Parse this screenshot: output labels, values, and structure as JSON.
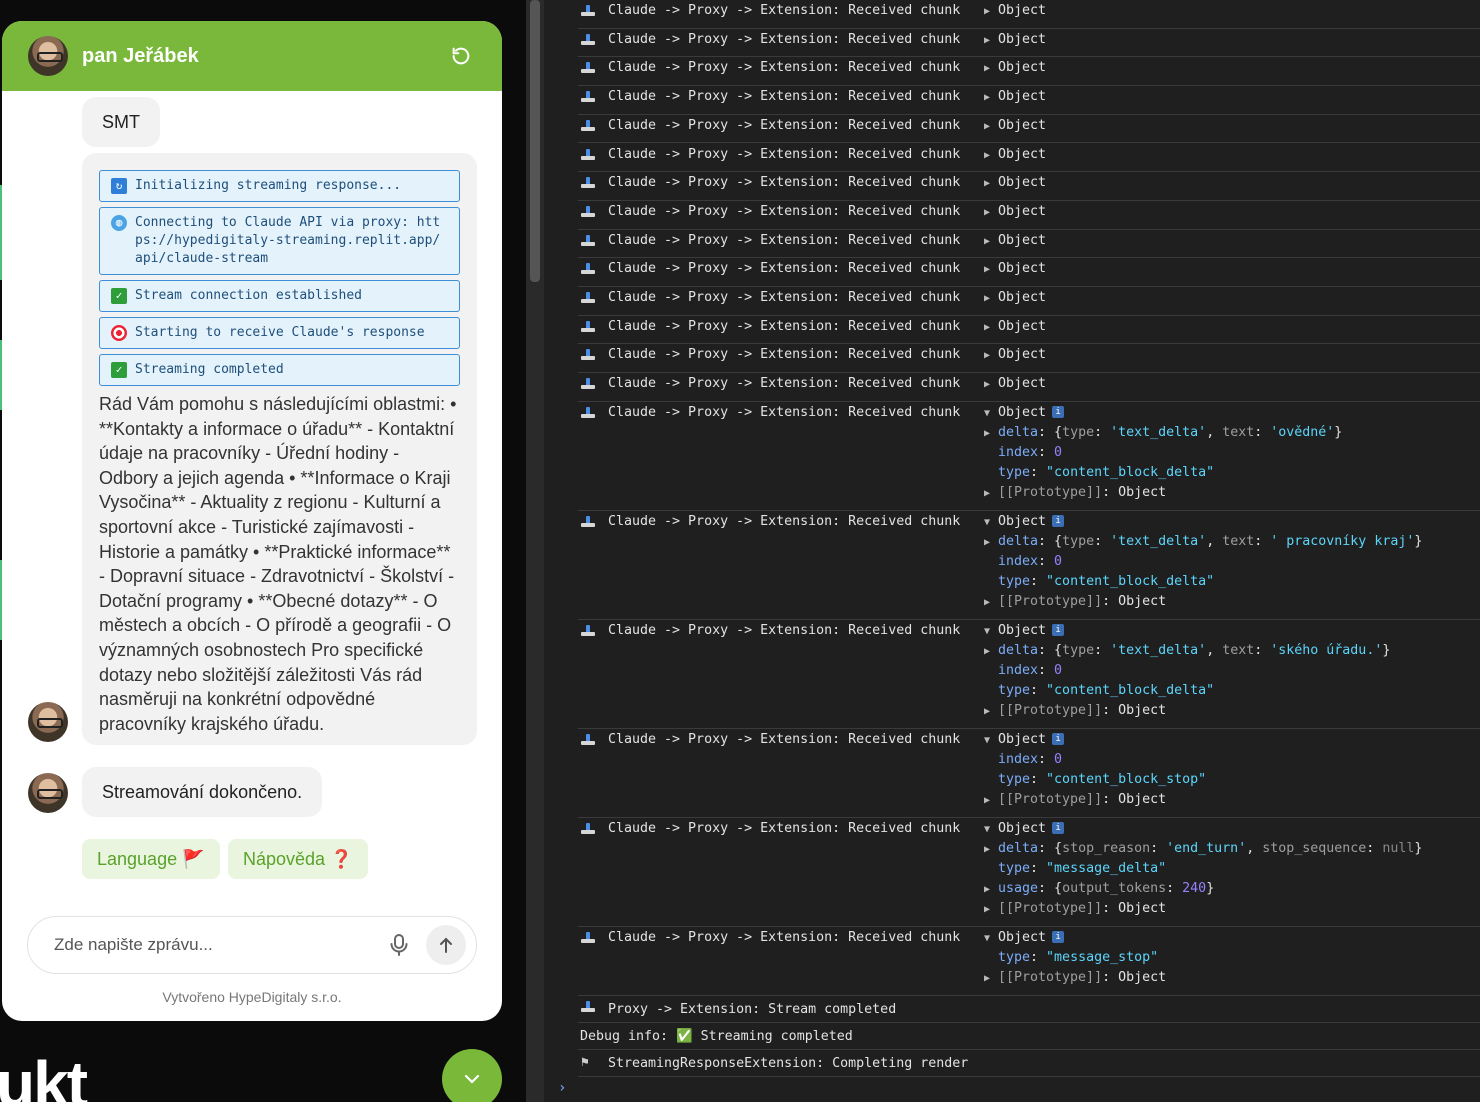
{
  "chat": {
    "bot_name": "pan Jeřábek",
    "user_message": "SMT",
    "status_lines": [
      {
        "icon": "refresh-icon",
        "text": "Initializing streaming response..."
      },
      {
        "icon": "globe-icon",
        "text": "Connecting to Claude API via proxy: https://hypedigitaly-streaming.replit.app/api/claude-stream"
      },
      {
        "icon": "checkmark-icon",
        "text": "Stream connection established"
      },
      {
        "icon": "target-icon",
        "text": "Starting to receive Claude's response"
      },
      {
        "icon": "checkmark-icon",
        "text": "Streaming completed"
      }
    ],
    "response_text": "Rád Vám pomohu s následujícími oblastmi: • **Kontakty a informace o úřadu** - Kontaktní údaje na pracovníky - Úřední hodiny - Odbory a jejich agenda • **Informace o Kraji Vysočina** - Aktuality z regionu - Kulturní a sportovní akce - Turistické zajímavosti - Historie a památky • **Praktické informace** - Dopravní situace - Zdravotnictví - Školství - Dotační programy • **Obecné dotazy** - O městech a obcích - O přírodě a geografii - O významných osobnostech Pro specifické dotazy nebo složitější záležitosti Vás rád nasměruji na konkrétní odpovědné pracovníky krajského úřadu.",
    "done_message": "Streamování dokončeno.",
    "quick_replies": [
      {
        "label": "Language",
        "emoji": "🚩"
      },
      {
        "label": "Nápověda",
        "emoji": "❓"
      }
    ],
    "input_placeholder": "Zde napište zprávu...",
    "footer": "Vytvořeno HypeDigitaly s.r.o."
  },
  "background": {
    "partial_text": "ukt"
  },
  "console": {
    "collapsed_log_text": "Claude -> Proxy -> Extension: Received chunk",
    "object_label": "Object",
    "collapsed_count": 14,
    "expanded_entries": [
      {
        "props": [
          {
            "arrow": true,
            "key": "delta",
            "value": "{type: 'text_delta', text: 'ovědné'}"
          },
          {
            "arrow": false,
            "key": "index",
            "value": "0"
          },
          {
            "arrow": false,
            "key": "type",
            "value": "\"content_block_delta\""
          },
          {
            "arrow": true,
            "key": "[[Prototype]]",
            "value": "Object"
          }
        ]
      },
      {
        "props": [
          {
            "arrow": true,
            "key": "delta",
            "value": "{type: 'text_delta', text: ' pracovníky kraj'}"
          },
          {
            "arrow": false,
            "key": "index",
            "value": "0"
          },
          {
            "arrow": false,
            "key": "type",
            "value": "\"content_block_delta\""
          },
          {
            "arrow": true,
            "key": "[[Prototype]]",
            "value": "Object"
          }
        ]
      },
      {
        "props": [
          {
            "arrow": true,
            "key": "delta",
            "value": "{type: 'text_delta', text: 'ského úřadu.'}"
          },
          {
            "arrow": false,
            "key": "index",
            "value": "0"
          },
          {
            "arrow": false,
            "key": "type",
            "value": "\"content_block_delta\""
          },
          {
            "arrow": true,
            "key": "[[Prototype]]",
            "value": "Object"
          }
        ]
      },
      {
        "props": [
          {
            "arrow": false,
            "key": "index",
            "value": "0"
          },
          {
            "arrow": false,
            "key": "type",
            "value": "\"content_block_stop\""
          },
          {
            "arrow": true,
            "key": "[[Prototype]]",
            "value": "Object"
          }
        ]
      },
      {
        "props": [
          {
            "arrow": true,
            "key": "delta",
            "value": "{stop_reason: 'end_turn', stop_sequence: null}"
          },
          {
            "arrow": false,
            "key": "type",
            "value": "\"message_delta\""
          },
          {
            "arrow": true,
            "key": "usage",
            "value": "{output_tokens: 240}"
          },
          {
            "arrow": true,
            "key": "[[Prototype]]",
            "value": "Object"
          }
        ]
      },
      {
        "props": [
          {
            "arrow": false,
            "key": "type",
            "value": "\"message_stop\""
          },
          {
            "arrow": true,
            "key": "[[Prototype]]",
            "value": "Object"
          }
        ]
      }
    ],
    "tail_lines": [
      {
        "icon": "package-icon",
        "text": "Proxy -> Extension: Stream completed"
      },
      {
        "icon": "",
        "text": "Debug info: ✅ Streaming completed"
      },
      {
        "icon": "flag-icon",
        "text": "StreamingResponseExtension: Completing render"
      }
    ],
    "prompt": "›"
  },
  "colors": {
    "brand": "#79b83a",
    "status_border": "#3d8ed6"
  }
}
